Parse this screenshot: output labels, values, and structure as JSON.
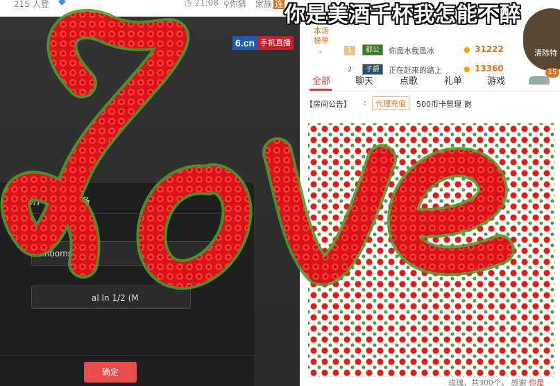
{
  "topbar": {
    "viewers": "215 人登",
    "time": "21:08",
    "location": "你猜",
    "family": "家族",
    "family_tag": "连"
  },
  "brand": {
    "logo": "6.cn",
    "tag": "手机直播"
  },
  "dialog": {
    "title": "启直播前，请选择设备",
    "device_select": "6RoomsC",
    "line_select": "al In 1/2 (M",
    "ok_button": "确定"
  },
  "rank": {
    "label_line1": "本场",
    "label_line2": "榜单",
    "rows": [
      {
        "num": "1",
        "badge": "都公",
        "name": "你是水我是冰",
        "value": "31222"
      },
      {
        "num": "2",
        "badge": "子爵",
        "name": "正在赶来的路上",
        "value": "13360"
      }
    ],
    "clear_button": "清除特"
  },
  "tabs": {
    "all": "全部",
    "chat": "聊天",
    "song": "点歌",
    "gift": "礼单",
    "game": "游戏",
    "car_badge": "15"
  },
  "notice": {
    "label": "【房间公告】",
    "colon": ":",
    "agent": "代理充值",
    "text": "500币卡管理 谢"
  },
  "footer": {
    "text": "玫瑰，共300个。",
    "thanks": "感谢",
    "me": "你是"
  },
  "overlay": {
    "banner": "你是美酒千杯我怎能不醉",
    "art_word": "Love",
    "rose_color": "#e01b1b",
    "leaf_color": "#4f9a2c"
  }
}
